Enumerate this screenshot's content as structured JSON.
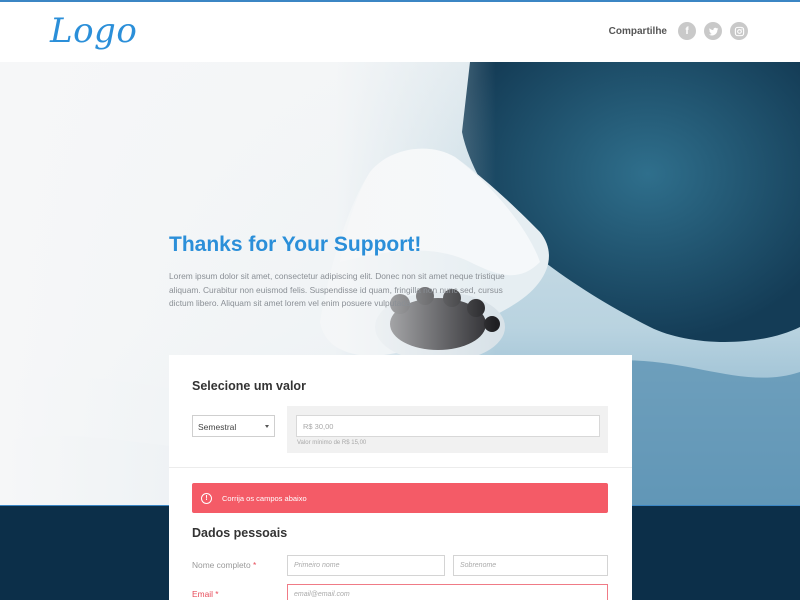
{
  "header": {
    "logo": "Logo",
    "share_label": "Compartilhe",
    "social": [
      {
        "icon": "facebook-icon",
        "glyph": "f"
      },
      {
        "icon": "twitter-icon",
        "glyph": ""
      },
      {
        "icon": "instagram-icon",
        "glyph": ""
      }
    ]
  },
  "hero": {
    "title": "Thanks for Your Support!",
    "text": "Lorem ipsum dolor sit amet, consectetur adipiscing elit. Donec non sit amet neque tristique aliquam. Curabitur non euismod felis. Suspendisse id quam, fringilla non nunc sed, cursus dictum libero. Aliquam sit amet lorem vel enim posuere vulputada."
  },
  "form": {
    "value_section": {
      "title": "Selecione um valor",
      "frequency": "Semestral",
      "amount_placeholder": "R$ 30,00",
      "amount_hint": "Valor mínimo de R$ 15,00"
    },
    "alert": {
      "icon": "!",
      "message": "Corrija os campos abaixo"
    },
    "personal": {
      "title": "Dados pessoais",
      "name_label": "Nome completo",
      "first_name_placeholder": "Primeiro nome",
      "last_name_placeholder": "Sobrenome",
      "email_label": "Email",
      "email_placeholder": "email@email.com",
      "required_mark": "*"
    }
  },
  "colors": {
    "accent": "#2b8fd9",
    "alert": "#f45b67",
    "dark_band": "#0c2f49"
  }
}
